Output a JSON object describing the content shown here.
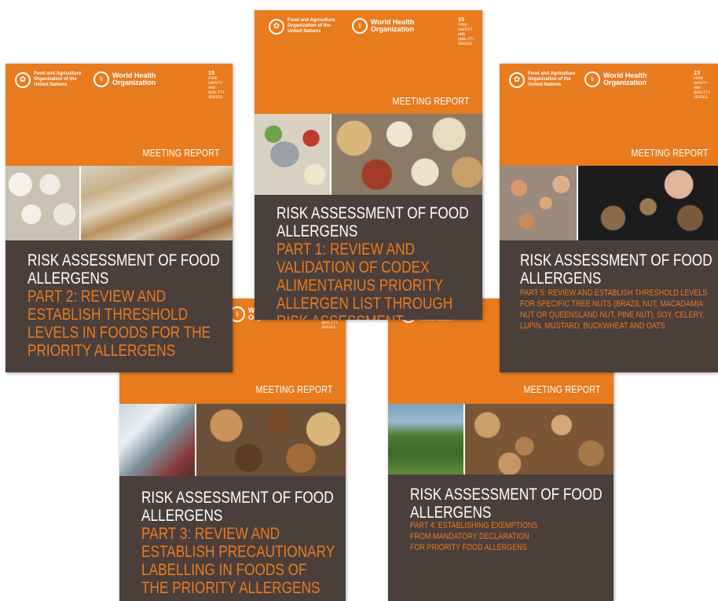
{
  "logos": {
    "fao": "Food and Agriculture Organization of the United Nations",
    "who": "World Health Organization",
    "series_label": [
      "FOOD",
      "SAFETY",
      "AND",
      "QUALITY",
      "SERIES"
    ]
  },
  "covers": {
    "part1": {
      "series_number": "16",
      "label": "MEETING REPORT",
      "title": "RISK ASSESSMENT OF FOOD ALLERGENS",
      "subtitle": "PART 1: REVIEW AND VALIDATION OF CODEX ALIMENTARIUS PRIORITY ALLERGEN LIST THROUGH RISK ASSESSMENT"
    },
    "part2": {
      "series_number": "15",
      "label": "MEETING REPORT",
      "title": "RISK ASSESSMENT OF FOOD ALLERGENS",
      "subtitle": "PART 2: REVIEW AND ESTABLISH THRESHOLD LEVELS IN FOODS FOR THE PRIORITY ALLERGENS"
    },
    "part3": {
      "label": "MEETING REPORT",
      "title": "RISK ASSESSMENT OF FOOD ALLERGENS",
      "subtitle": "PART 3: REVIEW AND ESTABLISH PRECAUTIONARY LABELLING IN FOODS OF THE PRIORITY ALLERGENS"
    },
    "part4": {
      "label": "MEETING REPORT",
      "title": "RISK ASSESSMENT OF FOOD ALLERGENS",
      "subtitle": "PART 4: ESTABLISHING EXEMPTIONS FROM MANDATORY DECLARATION FOR PRIORITY FOOD ALLERGENS"
    },
    "part5": {
      "series_number": "23",
      "label": "MEETING REPORT",
      "title": "RISK ASSESSMENT OF FOOD ALLERGENS",
      "subtitle": "PART 5: REVIEW AND ESTABLISH THRESHOLD LEVELS FOR SPECIFIC TREE NUTS (BRAZIL NUT, MACADAMIA NUT OR QUEENSLAND NUT, PINE NUT), SOY, CELERY, LUPIN, MUSTARD, BUCKWHEAT AND OATS"
    }
  },
  "colors": {
    "orange": "#e87b1e",
    "brown": "#4b3f3c"
  }
}
